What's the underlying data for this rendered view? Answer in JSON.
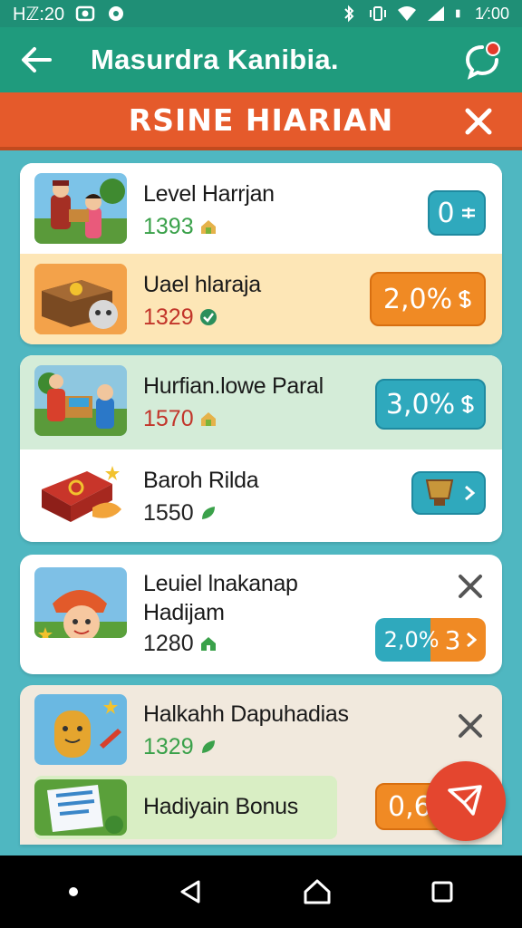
{
  "statusbar": {
    "time": "Hℤ:20",
    "clock_right": "1⁄:00"
  },
  "appbar": {
    "title": "Masurdra Kanibia."
  },
  "banner": {
    "title": "RSINE HIARIAN"
  },
  "items": [
    {
      "name": "Level Harrjan",
      "value": "1393",
      "action": "0"
    },
    {
      "name": "Uael hlaraja",
      "value": "1329",
      "action": "2,0%"
    },
    {
      "name": "Hurfian.lowe Paral",
      "value": "1570",
      "action": "3,0%"
    },
    {
      "name": "Baroh Rilda",
      "value": "1550"
    },
    {
      "name_line1": "Leuiel lnakanap",
      "name_line2": "Hadijam",
      "value": "1280",
      "action_left": "2,0%",
      "action_right": "3"
    },
    {
      "name": "Halkahh Dapuhadias",
      "value": "1329"
    },
    {
      "name": "Hadiyain Bonus",
      "action": "0,6"
    }
  ],
  "colors": {
    "accent_green": "#1f9b7d",
    "banner_orange": "#e55a2b",
    "pill_teal": "#2fa9bd",
    "pill_orange": "#f08a24",
    "fab_red": "#e4462f"
  },
  "icons": [
    "back-arrow-icon",
    "chat-icon",
    "close-icon",
    "currency-icon",
    "home-icon",
    "recent-icon"
  ]
}
